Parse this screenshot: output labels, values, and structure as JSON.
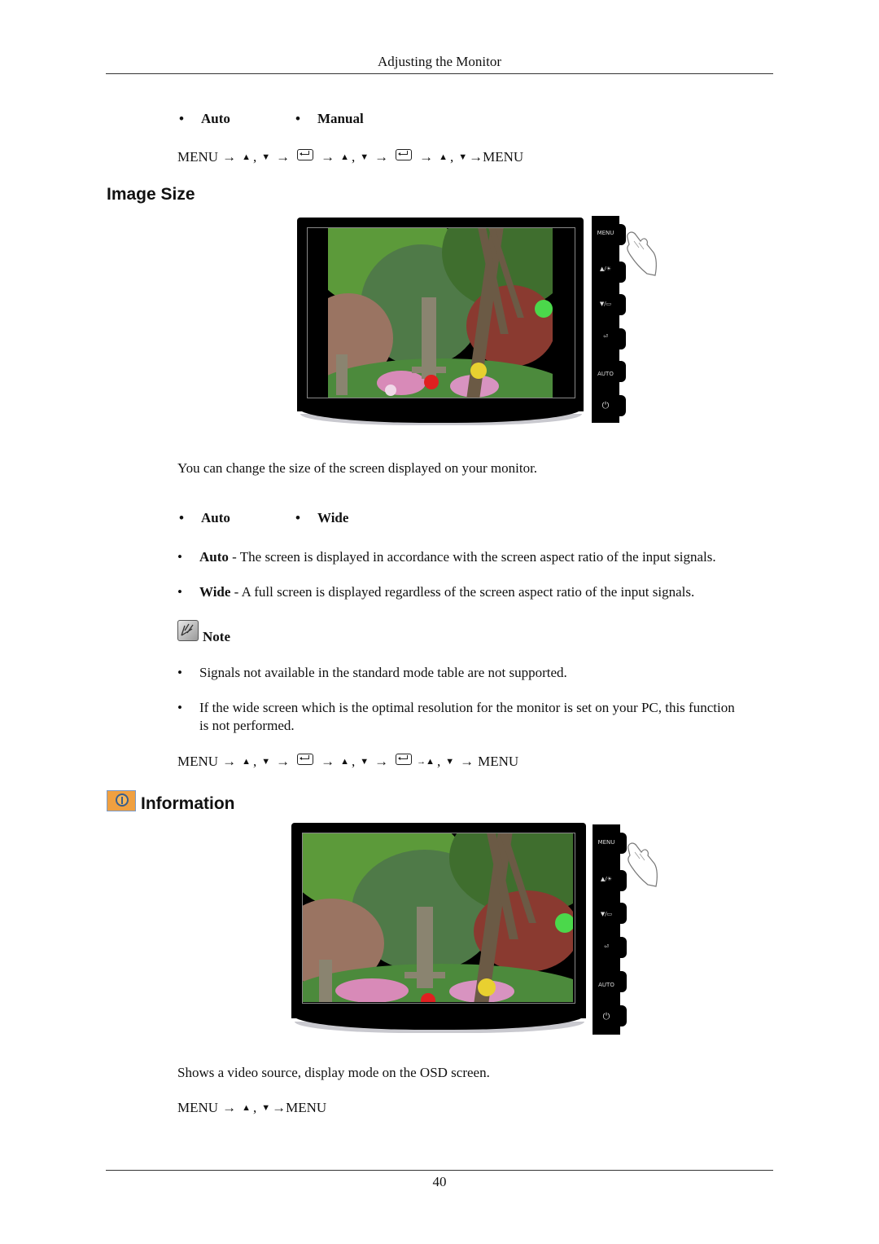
{
  "header": {
    "title": "Adjusting the Monitor"
  },
  "top_options": {
    "items": [
      "Auto",
      "Manual"
    ]
  },
  "sequence_1": {
    "parts": [
      "MENU",
      "→",
      "▲",
      ",",
      "▼",
      "→",
      "enter-icon",
      "→",
      "▲",
      ",",
      "▼",
      "→",
      "enter-icon",
      "→",
      "▲",
      ",",
      "▼",
      "→MENU"
    ]
  },
  "image_size": {
    "title": "Image Size",
    "illustration": {
      "buttons": [
        "MENU",
        "▲/☀",
        "▼/▭",
        "enter-icon",
        "AUTO",
        "power-icon"
      ]
    },
    "description": "You can change the size of the screen displayed on your monitor.",
    "options": [
      "Auto",
      "Wide"
    ],
    "details": [
      {
        "term": "Auto",
        "text": " - The screen is displayed in accordance with the screen aspect ratio of the input signals."
      },
      {
        "term": "Wide",
        "text": " - A full screen is displayed regardless of the screen aspect ratio of the input signals."
      }
    ],
    "note": {
      "label": "Note",
      "items": [
        "Signals not available in the standard mode table are not supported.",
        "If the wide screen which is the optimal resolution for the monitor is set on your PC, this function",
        "is not performed."
      ]
    },
    "sequence": {
      "parts": [
        "MENU",
        "→",
        "▲",
        ",",
        "▼",
        "→",
        "enter-icon",
        "→",
        "▲",
        ",",
        "▼",
        "→",
        "enter-icon",
        "→▲",
        ",",
        "▼",
        "→",
        "MENU"
      ]
    }
  },
  "information": {
    "title": "Information",
    "illustration": {
      "buttons": [
        "MENU",
        "▲/☀",
        "▼/▭",
        "enter-icon",
        "AUTO",
        "power-icon"
      ]
    },
    "description": "Shows a video source, display mode on the OSD screen.",
    "sequence": {
      "parts": [
        "MENU",
        "→",
        "▲",
        ",",
        "▼",
        "→MENU"
      ]
    }
  },
  "footer": {
    "page_number": "40"
  },
  "colors": {
    "info_icon_bg": "#f0a040",
    "info_icon_ring": "#3a5e8a",
    "rule": "#333333"
  }
}
